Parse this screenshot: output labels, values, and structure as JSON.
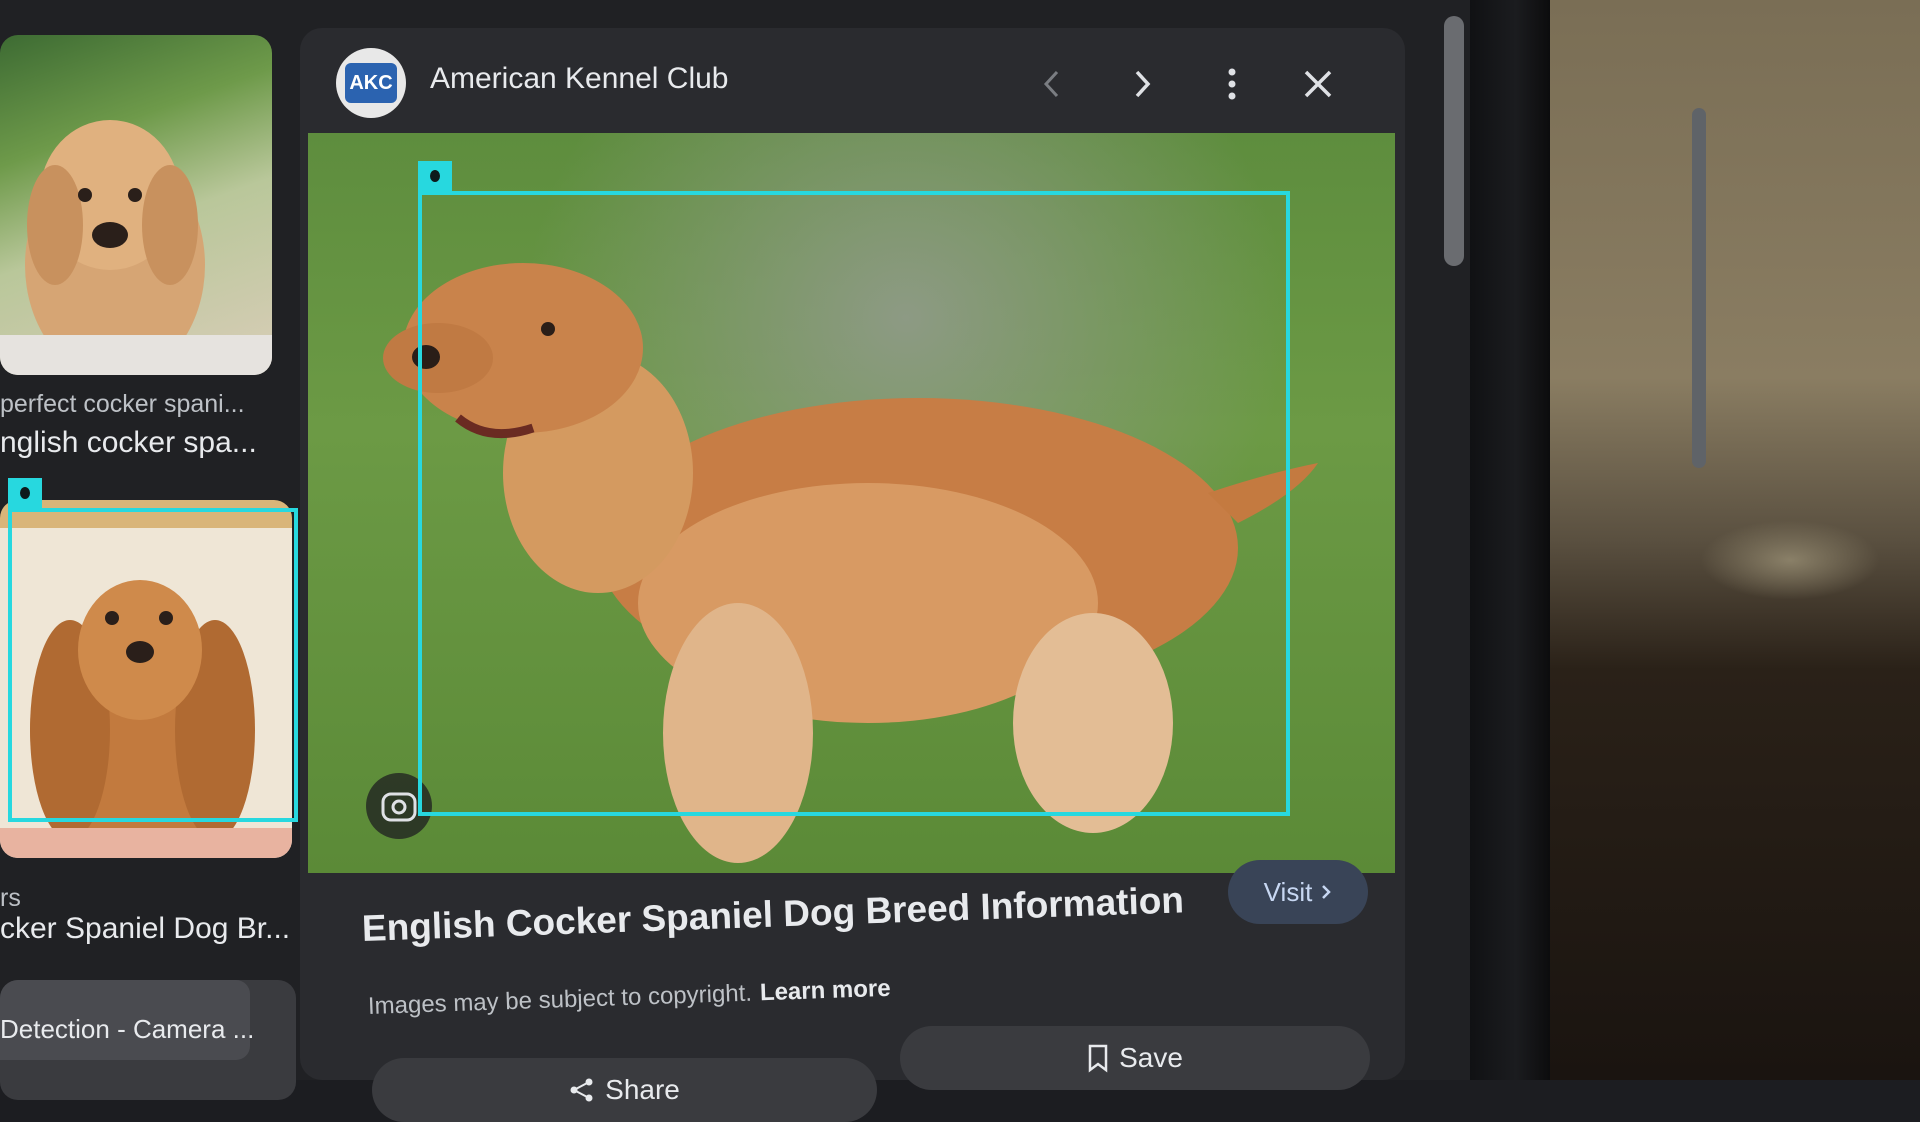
{
  "left_results": [
    {
      "source": "perfect cocker spani...",
      "title": "nglish cocker spa..."
    },
    {
      "source": "rs",
      "title": "cker Spaniel Dog Br..."
    },
    {
      "source": "",
      "title": "Detection - Camera ..."
    }
  ],
  "panel": {
    "source_logo_text": "AKC",
    "source_name": "American Kennel Club",
    "title": "English Cocker Spaniel Dog Breed Information",
    "copyright": "Images may be subject to copyright.",
    "learn_more": "Learn more",
    "visit_label": "Visit",
    "share_label": "Share",
    "save_label": "Save"
  },
  "colors": {
    "detection_box": "#27d8df",
    "panel_bg": "#2a2b2f",
    "visit_bg": "#394457"
  },
  "icons": {
    "prev": "chevron-left-icon",
    "next": "chevron-right-icon",
    "more": "more-vert-icon",
    "close": "close-icon",
    "lens": "google-lens-icon",
    "share": "share-icon",
    "save": "bookmark-icon"
  }
}
